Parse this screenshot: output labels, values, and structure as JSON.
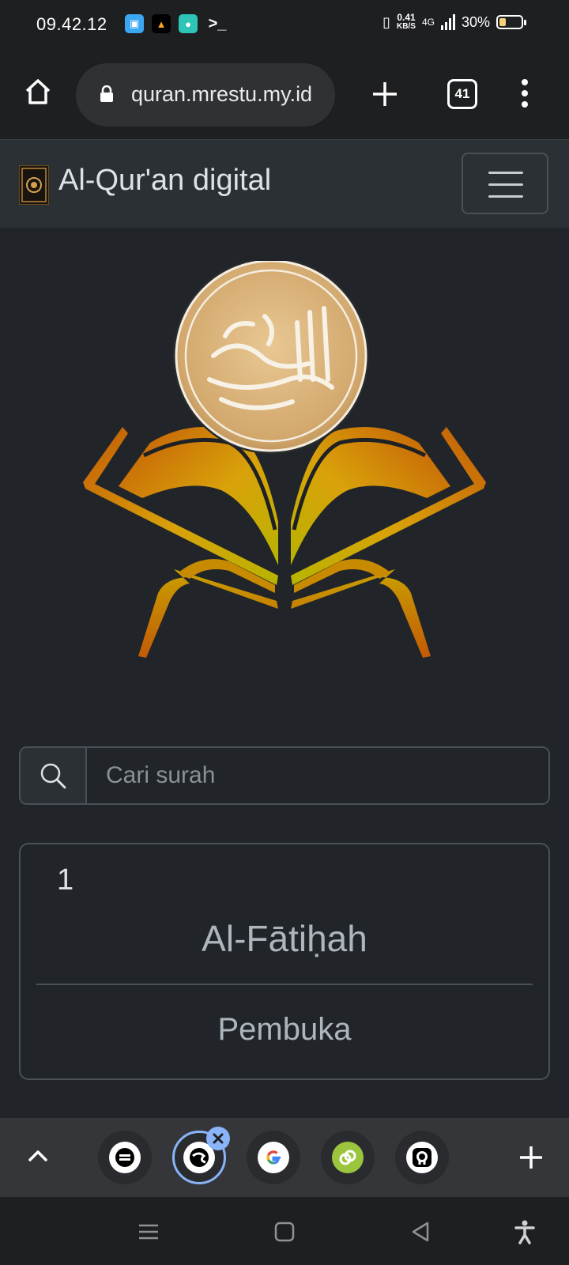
{
  "status_bar": {
    "time": "09.42.12",
    "speed_value": "0.41",
    "speed_unit": "KB/S",
    "network": "4G",
    "battery": "30%",
    "battery_level": 0.3
  },
  "browser": {
    "url": "quran.mrestu.my.id",
    "tab_count": "41"
  },
  "navbar": {
    "brand": "Al-Qur'an digital"
  },
  "search": {
    "placeholder": "Cari surah"
  },
  "surah_card": {
    "number": "1",
    "name": "Al-Fātiḥah",
    "meaning": "Pembuka"
  },
  "tab_strip": {
    "tabs": [
      "site-tab-1",
      "site-tab-2",
      "google-tab",
      "link-tab",
      "github-tab"
    ]
  },
  "colors": {
    "page_bg": "#212529",
    "navbar_bg": "#2b3035",
    "accent_blue": "#8ab4f8",
    "gold": "#d8b685"
  }
}
